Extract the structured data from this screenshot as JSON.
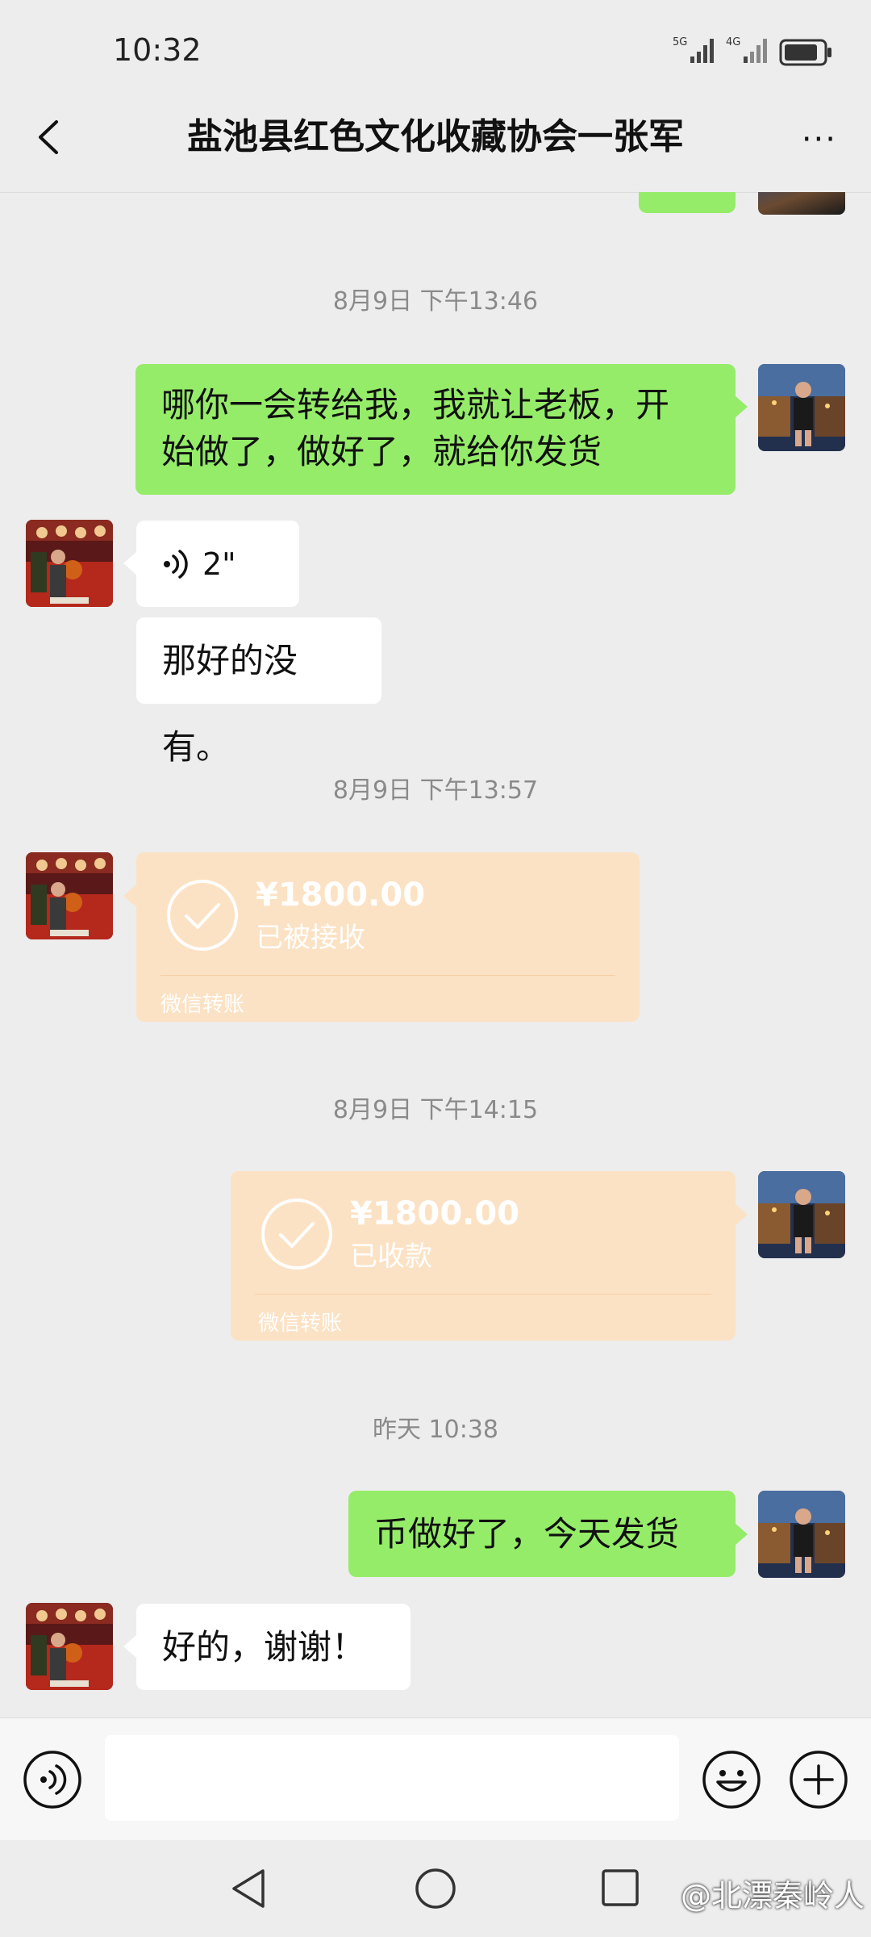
{
  "status_bar": {
    "time": "10:32",
    "net1": "5G",
    "net2": "4G"
  },
  "header": {
    "title": "盐池县红色文化收藏协会一张军",
    "more": "···"
  },
  "messages": {
    "ts1": "8月9日 下午13:46",
    "m1_line1": "哪你一会转给我，我就让老板，开",
    "m1_line2": "始做了，做好了，就给你发货",
    "voice_duration": "2\"",
    "m2": "那好的没有。",
    "ts2": "8月9日 下午13:57",
    "transfer1": {
      "amount": "¥1800.00",
      "status": "已被接收",
      "footer": "微信转账"
    },
    "ts3": "8月9日 下午14:15",
    "transfer2": {
      "amount": "¥1800.00",
      "status": "已收款",
      "footer": "微信转账"
    },
    "ts4": "昨天 10:38",
    "m3": "币做好了，今天发货",
    "m4": "好的，谢谢！"
  },
  "watermark": "@北漂秦岭人",
  "colors": {
    "bg": "#EDEDED",
    "green_bubble": "#95EC69",
    "transfer": "#FCE2C4"
  }
}
